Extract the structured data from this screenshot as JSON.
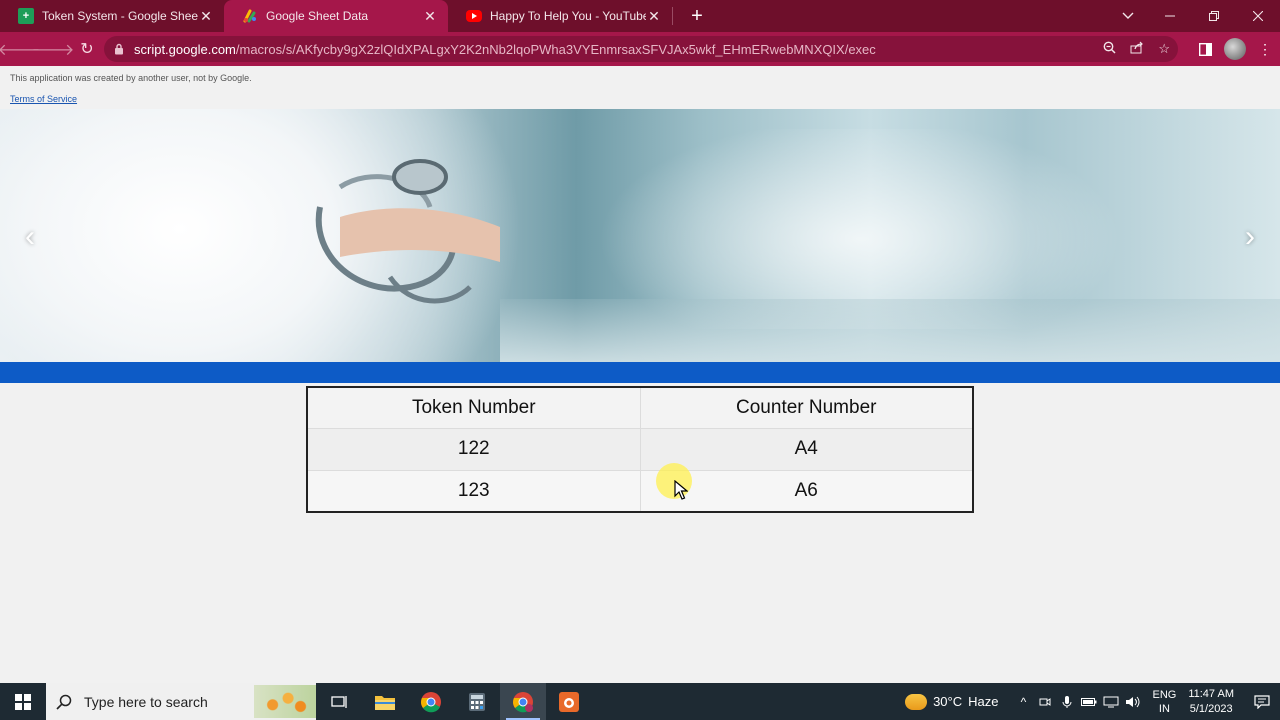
{
  "browser": {
    "tabs": [
      {
        "title": "Token System - Google Sheets",
        "icon": "sheets-icon",
        "active": false
      },
      {
        "title": "Google Sheet Data",
        "icon": "apps-script-icon",
        "active": true
      },
      {
        "title": "Happy To Help You - YouTube",
        "icon": "youtube-icon",
        "active": false
      }
    ],
    "url_host": "script.google.com",
    "url_path": "/macros/s/AKfycby9gX2zlQIdXPALgxY2K2nNb2lqoPWha3VYEnmrsaxSFVJAx5wkf_EHmERwebMNXQIX/exec",
    "accent_color": "#a5174a"
  },
  "page": {
    "notice": "This application was created by another user, not by Google.",
    "terms_link": "Terms of Service",
    "carousel": {
      "prev": "‹",
      "next": "›"
    },
    "table": {
      "headers": [
        "Token Number",
        "Counter Number"
      ],
      "rows": [
        [
          "122",
          "A4"
        ],
        [
          "123",
          "A6"
        ]
      ]
    }
  },
  "taskbar": {
    "search_placeholder": "Type here to search",
    "weather_temp": "30°C",
    "weather_desc": "Haze",
    "lang_top": "ENG",
    "lang_bottom": "IN",
    "time": "11:47 AM",
    "date": "5/1/2023"
  }
}
